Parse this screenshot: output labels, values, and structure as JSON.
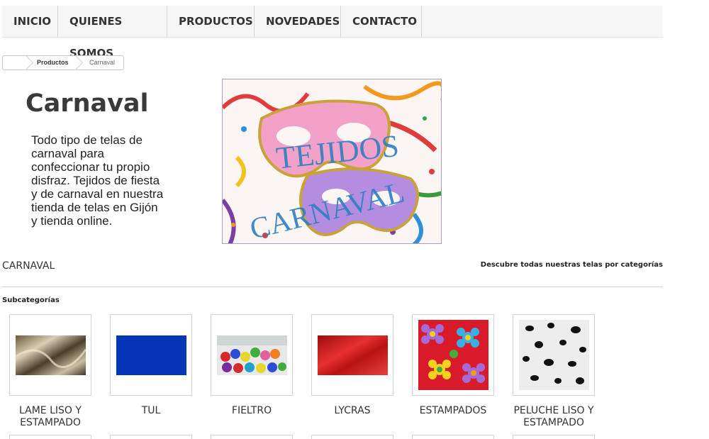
{
  "nav": {
    "items": [
      {
        "label": "INICIO"
      },
      {
        "label": "QUIENES SOMOS"
      },
      {
        "label": "PRODUCTOS"
      },
      {
        "label": "NOVEDADES"
      },
      {
        "label": "CONTACTO"
      }
    ]
  },
  "breadcrumb": {
    "items": [
      "Productos",
      "Carnaval"
    ]
  },
  "page": {
    "title": "Carnaval",
    "description": "Todo tipo de telas de\ncarnaval para\nconfeccionar tu propio\ndisfraz.  Tejidos de fiesta\ny de carnaval en nuestra\ntienda de telas en Gijón\ny tienda online.",
    "banner_text_line1": "TEJIDOS",
    "banner_text_line2": "CARNAVAL"
  },
  "category": {
    "name": "CARNAVAL",
    "link_label": "Descubre todas nuestras telas por categorías",
    "subcategories_heading": "Subcategorías"
  },
  "subcategories": [
    {
      "label": "LAME LISO Y ESTAMPADO",
      "icon": "fabric-gold-lame"
    },
    {
      "label": "TUL",
      "icon": "fabric-blue-tulle"
    },
    {
      "label": "FIELTRO",
      "icon": "fabric-felt-rolls"
    },
    {
      "label": "LYCRAS",
      "icon": "fabric-red-lycra"
    },
    {
      "label": "ESTAMPADOS",
      "icon": "fabric-flower-print"
    },
    {
      "label": "PELUCHE LISO Y ESTAMPADO",
      "icon": "fabric-dalmatian-plush"
    }
  ],
  "colors": {
    "nav_bg": "#f6f6f6",
    "banner_text": "#2f7fc1",
    "tul_blue": "#0636b8",
    "lycra_red": "#d21a1a"
  }
}
